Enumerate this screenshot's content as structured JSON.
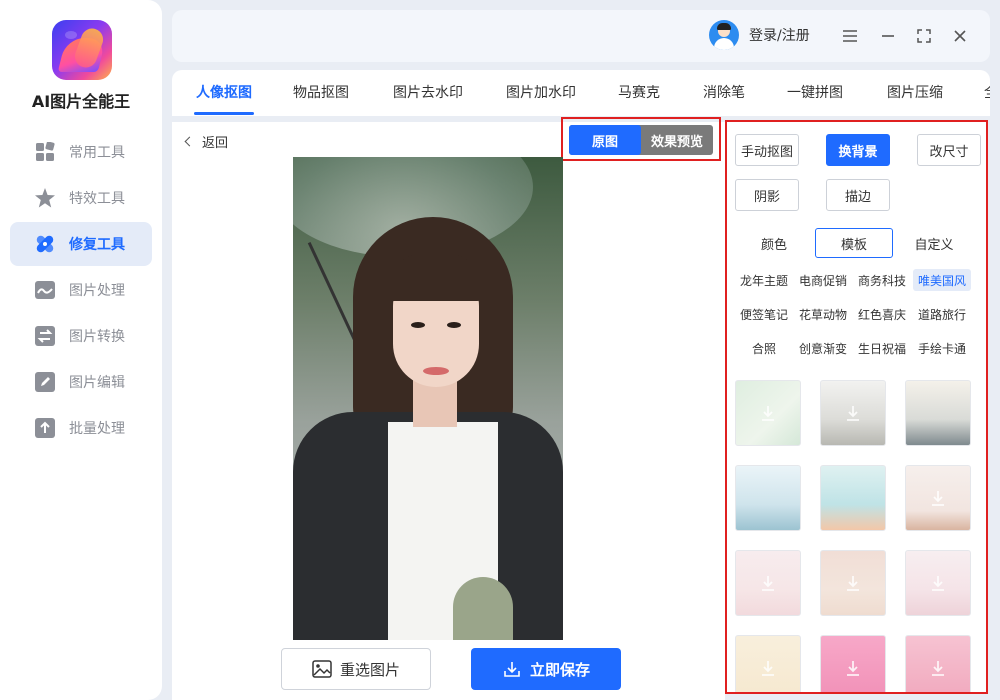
{
  "app": {
    "name": "AI图片全能王"
  },
  "sidebar": {
    "items": [
      {
        "label": "常用工具",
        "icon": "grid-icon"
      },
      {
        "label": "特效工具",
        "icon": "star-icon"
      },
      {
        "label": "修复工具",
        "icon": "bandage-icon",
        "active": true
      },
      {
        "label": "图片处理",
        "icon": "image-wave-icon"
      },
      {
        "label": "图片转换",
        "icon": "swap-icon"
      },
      {
        "label": "图片编辑",
        "icon": "edit-icon"
      },
      {
        "label": "批量处理",
        "icon": "upload-icon"
      }
    ]
  },
  "header": {
    "login_label": "登录/注册",
    "menu_icon": "menu-icon",
    "minimize_icon": "minimize-icon",
    "maximize_icon": "maximize-icon",
    "close_icon": "close-icon"
  },
  "tabs": [
    {
      "label": "人像抠图",
      "active": true
    },
    {
      "label": "物品抠图"
    },
    {
      "label": "图片去水印"
    },
    {
      "label": "图片加水印"
    },
    {
      "label": "马赛克"
    },
    {
      "label": "消除笔"
    },
    {
      "label": "一键拼图"
    },
    {
      "label": "图片压缩"
    },
    {
      "label": "全"
    }
  ],
  "main": {
    "back_label": "返回",
    "toggle": {
      "original": "原图",
      "preview": "效果预览",
      "selected": "原图"
    },
    "reselect_label": "重选图片",
    "save_label": "立即保存"
  },
  "panel": {
    "tools": [
      {
        "label": "手动抠图"
      },
      {
        "label": "换背景",
        "active": true
      },
      {
        "label": "改尺寸"
      },
      {
        "label": "阴影"
      },
      {
        "label": "描边"
      }
    ],
    "segments": [
      {
        "label": "颜色"
      },
      {
        "label": "模板",
        "active": true
      },
      {
        "label": "自定义"
      }
    ],
    "categories": [
      {
        "label": "龙年主题"
      },
      {
        "label": "电商促销"
      },
      {
        "label": "商务科技"
      },
      {
        "label": "唯美国风",
        "active": true
      },
      {
        "label": "便签笔记"
      },
      {
        "label": "花草动物"
      },
      {
        "label": "红色喜庆"
      },
      {
        "label": "道路旅行"
      },
      {
        "label": "合照"
      },
      {
        "label": "创意渐变"
      },
      {
        "label": "生日祝福"
      },
      {
        "label": "手绘卡通"
      }
    ]
  },
  "colors": {
    "accent": "#1f6bff",
    "highlight_frame": "#e02020",
    "sidebar_active_bg": "#e4ebf8"
  }
}
